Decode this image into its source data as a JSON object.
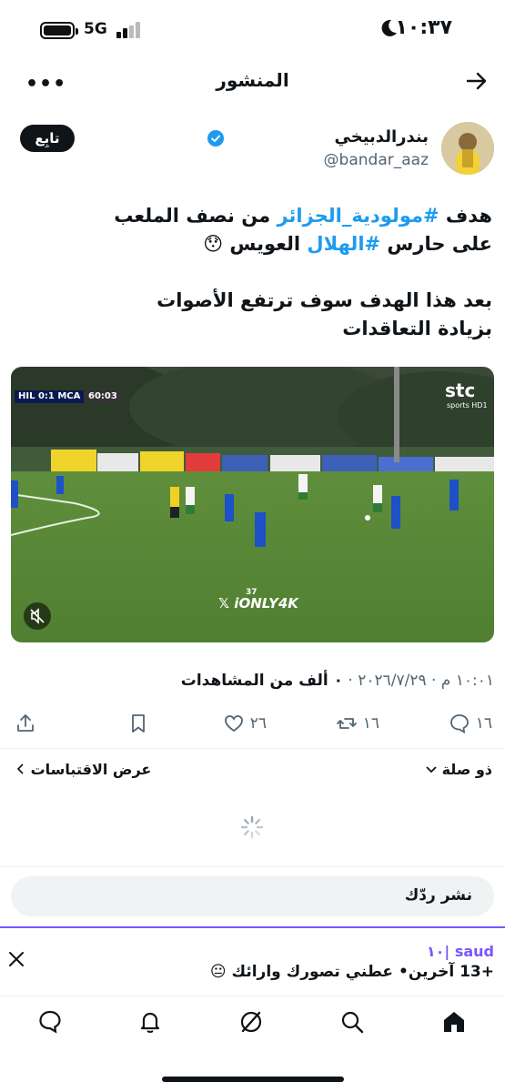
{
  "status_bar": {
    "time": "١٠:٣٧",
    "network": "5G"
  },
  "header": {
    "title": "المنشور",
    "back_icon": "arrow-right-icon",
    "more_icon": "ellipsis-icon",
    "more_label": "•••"
  },
  "author": {
    "name": "بندرالدبيخي",
    "handle": "@bandar_aaz",
    "follow_label": "تابِع",
    "verified": true
  },
  "tweet": {
    "line1_pre": "هدف ",
    "hashtag1": "#مولودية_الجزائر",
    "line1_post": " من نصف الملعب",
    "line2_pre": "على حارس ",
    "hashtag2": "#الهلال",
    "line2_post": " العويس 😯",
    "para2_line1": "بعد هذا الهدف سوف ترتفع الأصوات",
    "para2_line2": "بزيادة التعاقدات"
  },
  "media": {
    "scoreboard": "HIL 0:1 MCA",
    "match_clock": "60:03",
    "broadcaster": "stc",
    "broadcaster_sub": "sports HD1",
    "watermark": "𝕏 iONLY4K",
    "watermark_number": "37",
    "mute_icon": "speaker-muted-icon"
  },
  "meta": {
    "timestamp": "١٠:٠١ م · ٢٠٢٦/٧/٢٩ · ",
    "views_value": "٠ ألف",
    "views_label": " من المشاهدات"
  },
  "actions": {
    "replies": "١٦",
    "reposts": "١٦",
    "likes": "٢٦"
  },
  "relevance": {
    "sort_label": "ذو صلة",
    "quotes_label": "عرض الاقتباسات"
  },
  "reply_box": {
    "placeholder": "نشر ردّك"
  },
  "notification": {
    "user": "saud |١٠",
    "text": "+13 آخرين• عطني تصورك وارائك 😐"
  },
  "colors": {
    "accent": "#1d9bf0",
    "notification": "#7856ff",
    "text": "#0f1419",
    "muted": "#536471"
  }
}
